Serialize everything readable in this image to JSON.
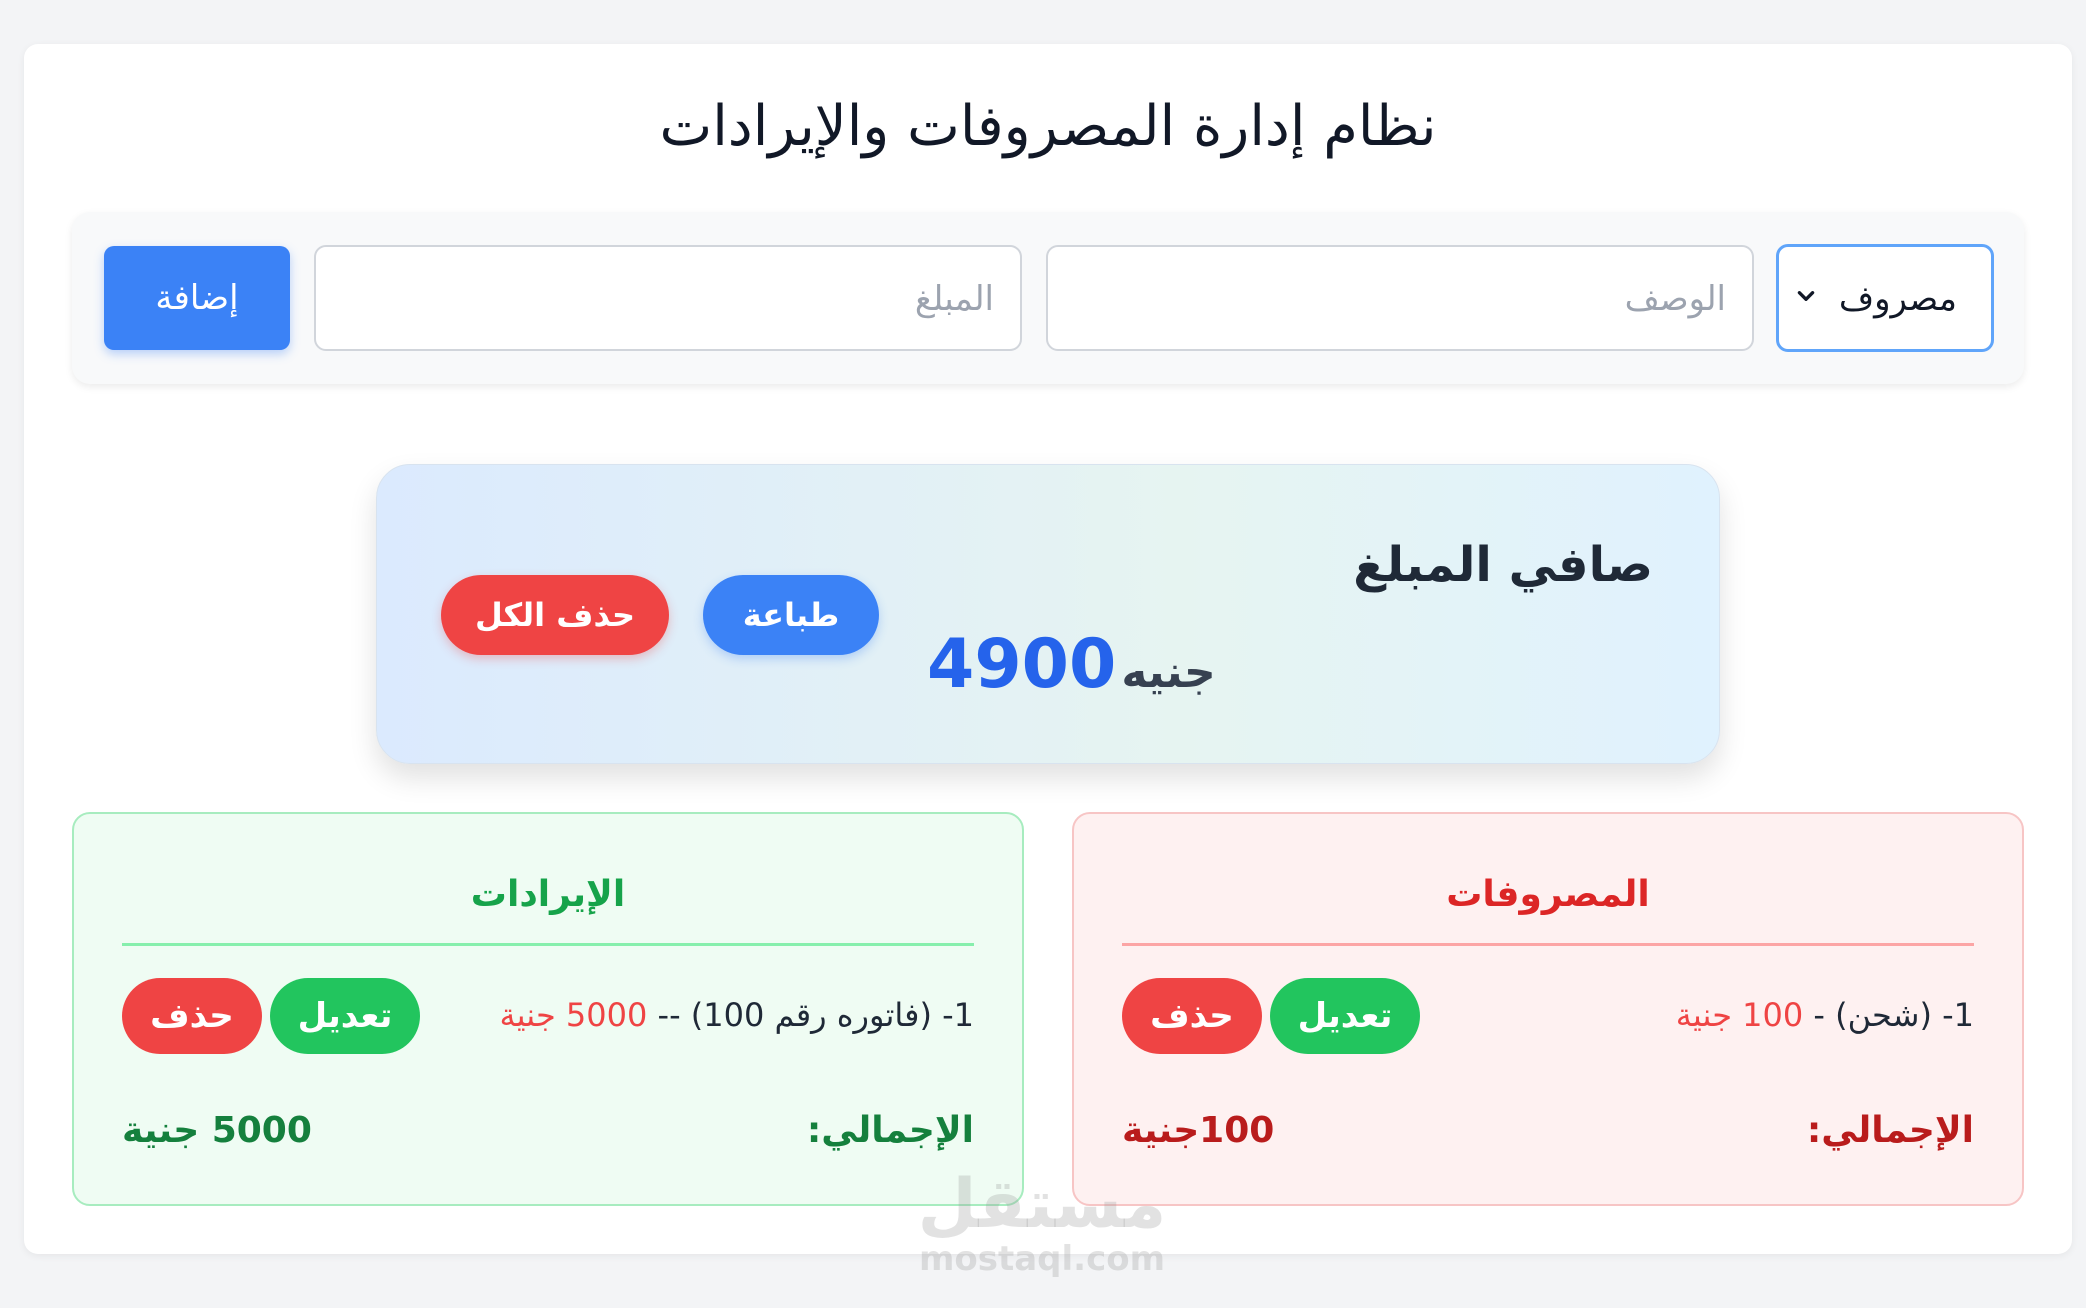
{
  "header": {
    "title": "نظام إدارة المصروفات والإيرادات"
  },
  "form": {
    "type_selected": "مصروف",
    "description_placeholder": "الوصف",
    "amount_placeholder": "المبلغ",
    "add_label": "إضافة"
  },
  "summary": {
    "title": "صافي المبلغ",
    "amount": "4900",
    "currency": "جنيه",
    "print_label": "طباعة",
    "delete_all_label": "حذف الكل"
  },
  "expenses": {
    "title": "المصروفات",
    "items": [
      {
        "prefix": "1- (شحن) - ",
        "amount": "100 جنية",
        "edit_label": "تعديل",
        "delete_label": "حذف"
      }
    ],
    "total_label": "الإجمالي:",
    "total_value": "100جنية"
  },
  "income": {
    "title": "الإيرادات",
    "items": [
      {
        "prefix": "1- (فاتوره رقم 100) -- ",
        "amount": "5000 جنية",
        "edit_label": "تعديل",
        "delete_label": "حذف"
      }
    ],
    "total_label": "الإجمالي:",
    "total_value": "5000 جنية"
  },
  "watermark": {
    "arabic": "مستقل",
    "latin": "mostaql.com"
  },
  "colors": {
    "primary": "#3b82f6",
    "danger": "#ef4444",
    "success": "#22c55e",
    "income_bg": "#effcf3",
    "expense_bg": "#fef1f1"
  }
}
